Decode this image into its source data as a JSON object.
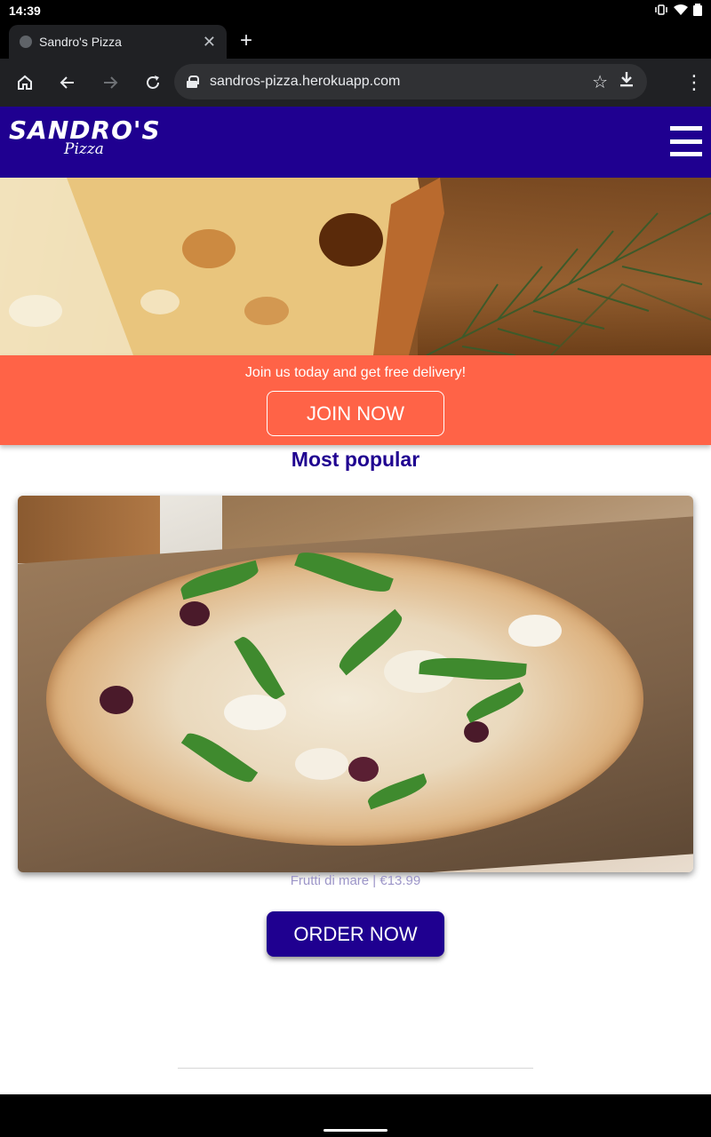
{
  "status_bar": {
    "time": "14:39",
    "icons": [
      "vibrate-icon",
      "wifi-icon",
      "battery-icon"
    ]
  },
  "browser": {
    "tab_title": "Sandro's Pizza",
    "url": "sandros-pizza.herokuapp.com",
    "toolbar_icons": [
      "home-icon",
      "back-icon",
      "forward-icon",
      "reload-icon",
      "lock-icon",
      "star-icon",
      "download-icon",
      "more-icon"
    ]
  },
  "site": {
    "logo_main": "SANDRO'S",
    "logo_sub": "Pizza",
    "colors": {
      "header": "#1f0090",
      "banner": "#ff6347",
      "caption": "#9c95c8"
    }
  },
  "banner": {
    "text": "Join us today and get free delivery!",
    "button_label": "JOIN NOW"
  },
  "popular": {
    "title": "Most popular",
    "item_caption": "Frutti di mare | €13.99",
    "button_label": "ORDER NOW"
  }
}
